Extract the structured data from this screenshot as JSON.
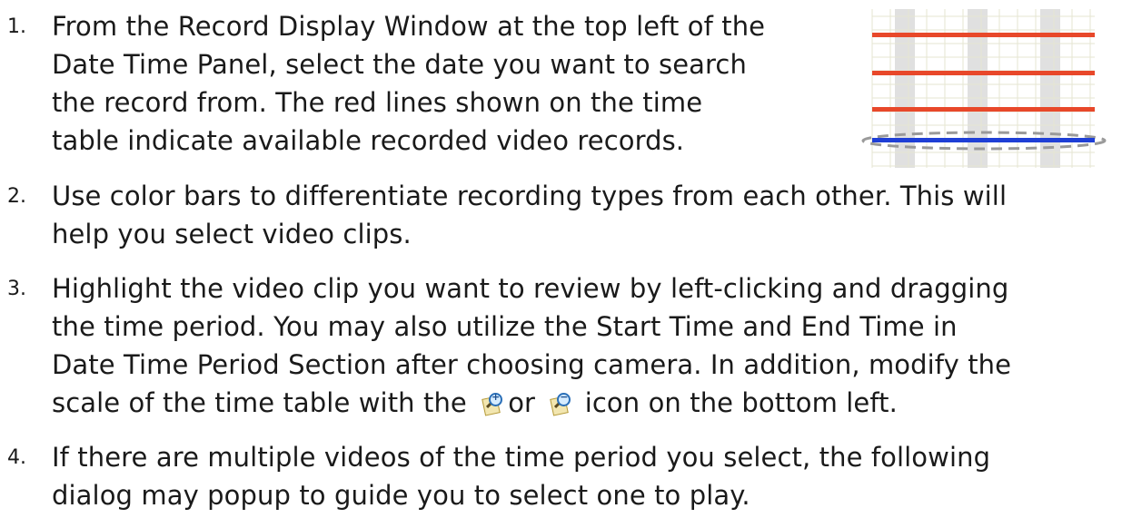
{
  "steps": [
    {
      "number": "1.",
      "lines": [
        "From the Record Display Window at the top left of the",
        "Date Time Panel, select the date you want to search",
        "the record from. The red lines shown on the time",
        "table indicate available recorded video records."
      ]
    },
    {
      "number": "2.",
      "lines": [
        "Use color bars to differentiate recording types from each other. This will",
        "help you select video clips."
      ]
    },
    {
      "number": "3.",
      "lines": [
        "Highlight the video clip you want to review by left-clicking and dragging",
        "the time period. You may also utilize the Start Time and End Time in",
        "Date Time Period Section after choosing camera. In addition, modify the"
      ],
      "last_line": {
        "before": "scale of the time table with the",
        "between": "or",
        "after": "icon on the bottom left.",
        "icon_1": "zoom-in-icon",
        "icon_2": "zoom-out-icon"
      }
    },
    {
      "number": "4.",
      "lines": [
        "If there are multiple videos of the time period you select, the following",
        "dialog may popup to guide you to select one to play."
      ]
    }
  ],
  "time_table": {
    "record_color": "#e8482a",
    "selected_color": "#1f3fd6",
    "grid_color": "#e6e6d2",
    "column_shade": "#e0e0e0",
    "highlight_outline_color": "#9a9a9a"
  }
}
